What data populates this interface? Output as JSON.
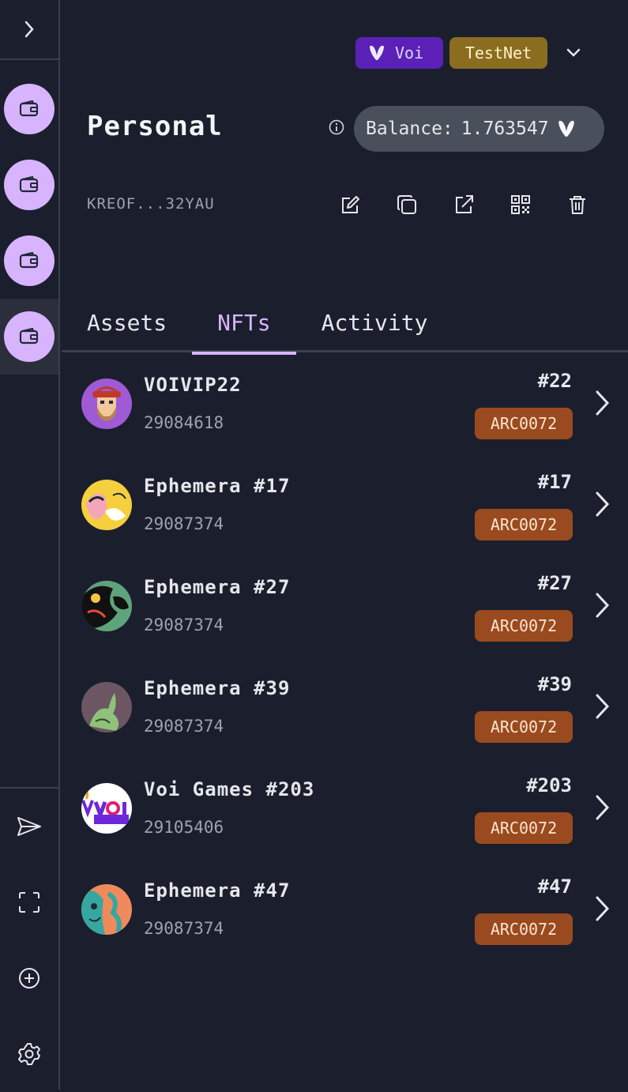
{
  "sidebar": {
    "expand_icon": "chevron-right-icon",
    "accounts": [
      {
        "icon": "wallet-icon",
        "active": false
      },
      {
        "icon": "wallet-icon",
        "active": false
      },
      {
        "icon": "wallet-icon",
        "active": false
      },
      {
        "icon": "wallet-icon",
        "active": true
      }
    ],
    "tools": [
      "send-icon",
      "scan-icon",
      "add-circle-icon",
      "settings-icon"
    ]
  },
  "network": {
    "chain_label": "Voi",
    "env_label": "TestNet",
    "chain_color": "#5b21b6",
    "env_color": "#8a6d1f"
  },
  "account": {
    "name": "Personal",
    "balance_label": "Balance:",
    "balance_value": "1.763547",
    "address": "KREOF...32YAU"
  },
  "tabs": [
    {
      "label": "Assets",
      "active": false
    },
    {
      "label": "NFTs",
      "active": true
    },
    {
      "label": "Activity",
      "active": false
    }
  ],
  "nfts": [
    {
      "name": "VOIVIP22",
      "app_id": "29084618",
      "serial": "#22",
      "standard": "ARC0072"
    },
    {
      "name": "Ephemera #17",
      "app_id": "29087374",
      "serial": "#17",
      "standard": "ARC0072"
    },
    {
      "name": "Ephemera #27",
      "app_id": "29087374",
      "serial": "#27",
      "standard": "ARC0072"
    },
    {
      "name": "Ephemera #39",
      "app_id": "29087374",
      "serial": "#39",
      "standard": "ARC0072"
    },
    {
      "name": "Voi Games #203",
      "app_id": "29105406",
      "serial": "#203",
      "standard": "ARC0072"
    },
    {
      "name": "Ephemera #47",
      "app_id": "29087374",
      "serial": "#47",
      "standard": "ARC0072"
    }
  ],
  "colors": {
    "accent": "#d8b4fe",
    "badge": "#9a4a1f",
    "background": "#1b1f2d"
  }
}
